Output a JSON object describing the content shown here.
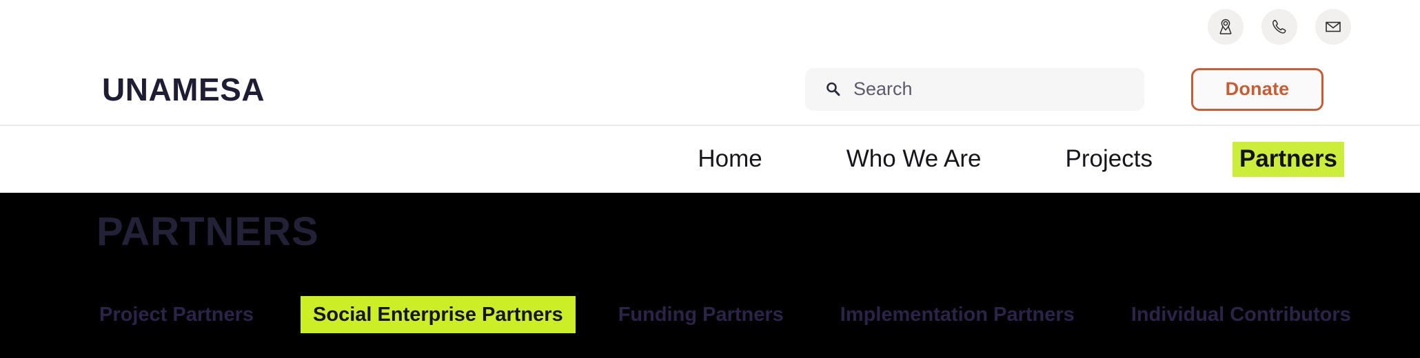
{
  "utility_bar": {
    "icons": [
      {
        "name": "location-pin-icon",
        "glyph": "location"
      },
      {
        "name": "phone-icon",
        "glyph": "phone"
      },
      {
        "name": "mail-icon",
        "glyph": "mail"
      }
    ]
  },
  "header": {
    "brand": "UNAMESA",
    "search": {
      "placeholder": "Search",
      "value": "",
      "icon": "search-icon"
    },
    "donate_label": "Donate"
  },
  "nav": {
    "items": [
      {
        "label": "Home",
        "active": false
      },
      {
        "label": "Who We Are",
        "active": false
      },
      {
        "label": "Projects",
        "active": false
      },
      {
        "label": "Partners",
        "active": true
      }
    ]
  },
  "hero": {
    "title": "PARTNERS",
    "tabs": [
      {
        "label": "Project Partners",
        "active": false
      },
      {
        "label": "Social Enterprise Partners",
        "active": true
      },
      {
        "label": "Funding Partners",
        "active": false
      },
      {
        "label": "Implementation Partners",
        "active": false
      },
      {
        "label": "Individual Contributors",
        "active": false
      }
    ]
  },
  "colors": {
    "accent_highlight": "#ccee3a",
    "accent_highlight_alt": "#ccee26",
    "donate_orange": "#c95c33",
    "brand_navy": "#1e1d33",
    "hero_background": "#000000",
    "hero_title": "#232138",
    "hero_tab_text": "#2b2348",
    "search_background": "#f6f6f7",
    "icon_circle": "#f1f0ef"
  }
}
